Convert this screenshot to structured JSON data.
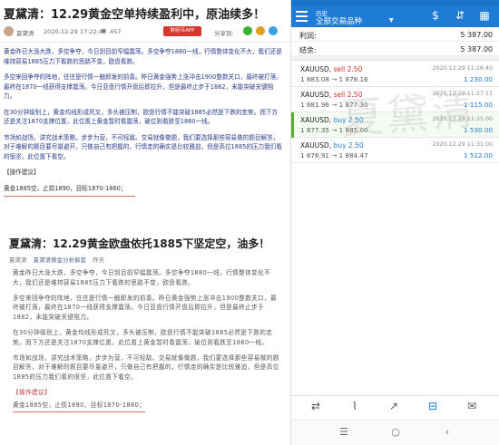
{
  "article1": {
    "title": "夏黛清：12.29黄金空单持续盈利中，原油续多！",
    "author": "夏黛清",
    "date": "2020-12-29 17:22:43",
    "eye_icon": "◉",
    "views": "457",
    "follow_label": "财经币APP",
    "share_label": "分享到:",
    "paragraphs": [
      "黄金昨日大涨大跌，多空争夺，今日到目前窄幅震荡。多空争夺1880一线，行情整体变化不大，我们还是维持容易1885压力下看跌的思路不变，欧盘看跌。",
      "多空来回争夺的阵地，往往是行情一触即发的前奏。昨日黄金强势上涨冲击1900整数关口，最终被打落，最终在1870一线获得支撑震荡。今日亚盘行情开盘后即拉升，但是最终止步于1882，未能突破关键阻力。",
      "在30分钟级别上，黄金均线形成死叉，多头被压制，欧盘行情不能突破1885必然是下跌的走势。而下方还是关注1870支撑位置，此位置上黄金暂时看震荡，破位则看跌至1860一线。",
      "市场如战场，讲究战术策略，步步为营，不可轻敌。交易就像做题，我们要选择那些容易做的题目解答，对于难解的题目要尽量避开，只做自己有把握的，行情走的确实是比较雅迫，但是高位1885的压力我们看的很坚，此位置下看空。"
    ],
    "caption": "【操作建议】",
    "advice": "黄金1885空，止损1890，目标1870-1860；"
  },
  "article2": {
    "title": "夏黛清：12.29黄金欧盘依托1885下坚定空，油多！",
    "author": "夏黛清",
    "publisher": "夏黛清黄金分析解套",
    "when": "昨天",
    "paragraphs": [
      "黄金昨日大涨大跌，多空争夺，今日到目前窄幅震荡。多空争夺1880一线，行情整体变化不大，我们还是维持容易1885压力下看跌的思路不变，欧盘看跌。",
      "多空来回争夺的阵地，往往是行情一触即发的前奏。昨日黄金强势上涨冲击1900整数关口，最终被打落，最终在1870一线获得支撑震荡。今日亚盘行情开盘后即拉升，但是最终止步于1882，未能突破关键阻力。",
      "在30分钟级别上，黄金均线形成死叉，多头被压制，欧盘行情不能突破1885必然是下跌的走势。而下方还是关注1870支撑位置，此位置上黄金暂时看震荡，破位则看跌至1860一线。",
      "市场如战场，讲究战术策略，步步为营，不可轻敌。交易就像做题，我们要选择那些容易做的题目解答，对于难解的题目要尽量避开，只做自己有把握的，行情走的确实是比较雅迫，但是高位1885的压力我们看的很坚，此位置下看空。"
    ],
    "caption": "【操作建议】",
    "advice": "黄金1885空，止损1890，目标1870-1860；"
  },
  "app": {
    "subtitle": "历史",
    "title": "全部交易品种",
    "caret": "▼",
    "toolbar_icons": {
      "sort": "⇵",
      "dollar": "$",
      "calendar": "▦"
    },
    "summary": [
      {
        "label": "利润:",
        "value": "5 387.00"
      },
      {
        "label": "结余:",
        "value": "5 387.00"
      }
    ],
    "trades": [
      {
        "symbol": "XAUUSD,",
        "side": "sell 2.50",
        "open": "1 883.08",
        "arrow": "→",
        "close": "1 878.16",
        "time": "2020.12.29 11:26:40",
        "profit": "1 230.00",
        "buy": false,
        "selected": false
      },
      {
        "symbol": "XAUUSD,",
        "side": "sell 2.50",
        "open": "1 881.96",
        "arrow": "→",
        "close": "1 877.30",
        "time": "2020.12.29 11:27:11",
        "profit": "1 115.00",
        "buy": false,
        "selected": false
      },
      {
        "symbol": "XAUUSD,",
        "side": "buy 2.50",
        "open": "1 877.35",
        "arrow": "→",
        "close": "1 885.00",
        "time": "2020.12.29 11:31:00",
        "profit": "1 530.00",
        "buy": true,
        "selected": true
      },
      {
        "symbol": "XAUUSD,",
        "side": "buy 2.50",
        "open": "1 876.91",
        "arrow": "→",
        "close": "1 884.47",
        "time": "2020.12.29 11:31:00",
        "profit": "1 512.00",
        "buy": true,
        "selected": false
      }
    ],
    "watermark": "夏黛清",
    "nav_icons": {
      "quotes": "⇄",
      "chart": "⌇",
      "trade": "↗",
      "history": "⊟",
      "messages": "✉"
    },
    "sys_icons": {
      "menu": "☰",
      "home": "○",
      "back": "‹"
    }
  }
}
